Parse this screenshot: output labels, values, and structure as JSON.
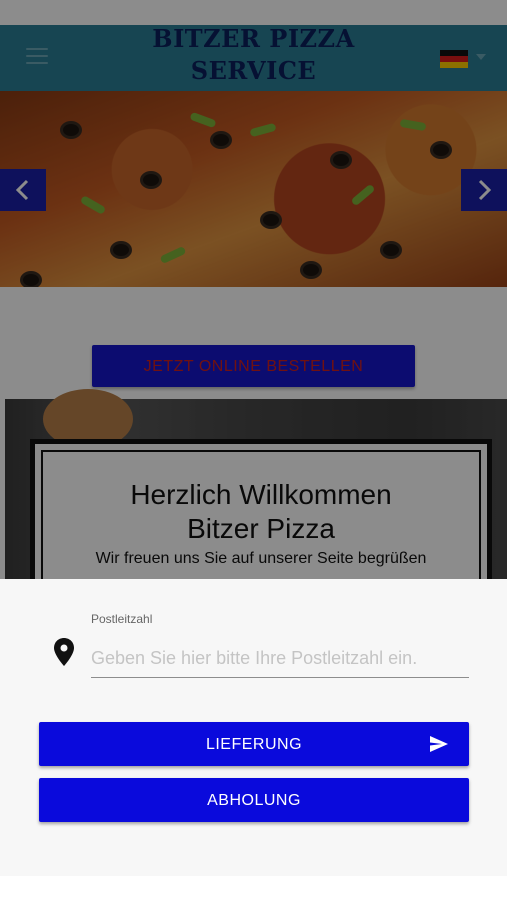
{
  "header": {
    "brand_line1": "BITZER PIZZA",
    "brand_line2": "SERVICE",
    "menu_icon": "hamburger-icon",
    "language_flag": "germany-flag-icon",
    "colors": {
      "header_bg": "#2a7f96",
      "brand_text": "#0b1f5e"
    }
  },
  "slider": {
    "prev_icon": "chevron-left-icon",
    "next_icon": "chevron-right-icon"
  },
  "main": {
    "order_button_label": "JETZT ONLINE BESTELLEN",
    "welcome_title_line1": "Herzlich Willkommen",
    "welcome_title_line2": "Bitzer Pizza",
    "welcome_subtitle": "Wir freuen uns Sie auf unserer Seite begrüßen"
  },
  "sheet": {
    "zip_label": "Postleitzahl",
    "zip_placeholder": "Geben Sie hier bitte Ihre Postleitzahl ein.",
    "zip_value": "",
    "location_icon": "map-pin-icon",
    "delivery_label": "LIEFERUNG",
    "delivery_icon": "send-icon",
    "pickup_label": "ABHOLUNG",
    "colors": {
      "button_bg": "#0a0adc",
      "button_text": "#ffffff"
    }
  }
}
